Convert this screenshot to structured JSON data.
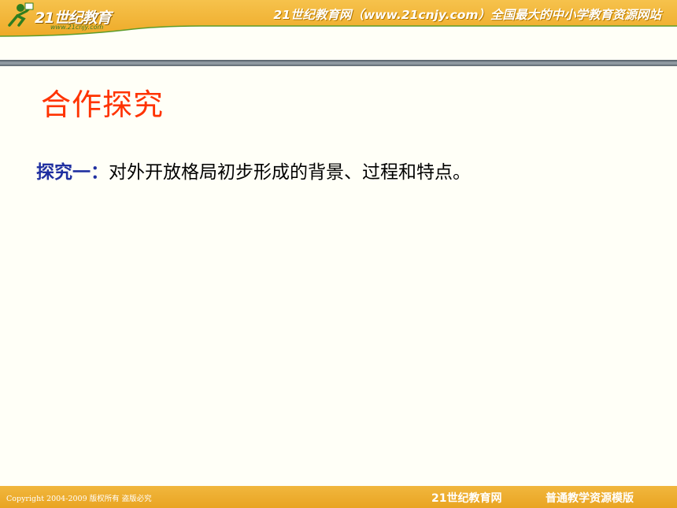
{
  "header": {
    "logo_text": "21世纪教育",
    "logo_url": "www.21cnjy.com",
    "slogan": "21世纪教育网（www.21cnjy.com）全国最大的中小学教育资源网站"
  },
  "slide": {
    "title": "合作探究",
    "question_label": "探究一：",
    "question_text": "对外开放格局初步形成的背景、过程和特点。"
  },
  "footer": {
    "copyright": "Copyright 2004-2009 版权所有 盗版必究",
    "site_name": "21世纪教育网",
    "template_name": "普通教学资源模版"
  },
  "colors": {
    "accent": "#ff3300",
    "label": "#1f2fa0",
    "band": "#eeaa28",
    "background": "#fffff7"
  }
}
